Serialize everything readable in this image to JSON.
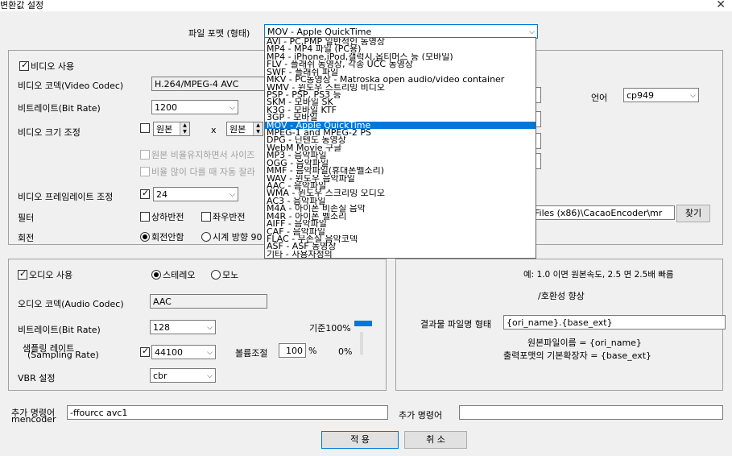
{
  "window": {
    "title": "변환값 설정",
    "close": "✕"
  },
  "format": {
    "label": "파일 포맷 (형태)",
    "selected": "MOV - Apple QuickTime",
    "options": [
      "AVI - PC,PMP 일반적인 동영상",
      "MP4 - MP4 파일 (PC용)",
      "MP4 - iPhone,iPod,갤럭시,옵티머스 등 (모바일)",
      "FLV - 플래쉬 동영상, 각종 UCC 동영상",
      "SWF - 플래쉬 파일",
      "MKV - PC동영상 - Matroska open audio/video container",
      "WMV - 윈도우 스트리밍 비디오",
      "PSP - PSP, PS3 등",
      "SKM - 모바일 SK",
      "K3G - 모바일 KTF",
      "3GP - 모바일",
      "MOV - Apple QuickTime",
      "MPEG-1 and MPEG-2 PS",
      "DPG - 닌텐도 동영상",
      "WebM Movie 구글",
      "MP3 - 음악파일",
      "OGG - 음악파일",
      "MMF - 음악파일(휴대폰벨소리)",
      "WAV - 윈도우 음악파일",
      "AAC - 음악파일",
      "WMA - 윈도우 스크리밍 오디오",
      "AC3 - 음악파일",
      "M4A - 아이폰 비손실 음악",
      "M4R - 아이폰 벨소리",
      "AIFF - 음악파일",
      "CAF - 음악파일",
      "FLAC - 무손실 음악코덱",
      "ASF - ASF 동영상",
      "기타 - 사용자정의"
    ],
    "selected_index": 11
  },
  "video": {
    "enable_label": "비디오 사용",
    "codec_label": "비디오 코덱(Video Codec)",
    "codec_value": "H.264/MPEG-4 AVC",
    "bitrate_label": "비트레이트(Bit Rate)",
    "bitrate_value": "1200",
    "size_label": "비디오 크기 조정",
    "size_w": "원본",
    "size_x": "x",
    "size_h": "원본",
    "keep_ratio": "원본 비율유지하면서 사이즈",
    "auto_crop": "비율 많이 다를 때 자동 잘라",
    "fps_label": "비디오 프레임레이트 조정",
    "fps_value": "24",
    "filter_label": "필터",
    "flip_v": "상하반전",
    "flip_h": "좌우반전",
    "rotate_label": "회전",
    "rotate_none": "회전안함",
    "rotate_cw": "시계 방향 90"
  },
  "right_top": {
    "lang_label": "언어",
    "lang_value": "cp949",
    "path_value": "Files (x86)\\CacaoEncoder\\mr",
    "browse": "찾기"
  },
  "audio": {
    "enable_label": "오디오 사용",
    "stereo": "스테레오",
    "mono": "모노",
    "codec_label": "오디오 코덱(Audio Codec)",
    "codec_value": "AAC",
    "bitrate_label": "비트레이트(Bit Rate)",
    "bitrate_value": "128",
    "base_label": "기준100%",
    "sampling_label1": "샘플링 레이트",
    "sampling_label2": "(Sampling Rate)",
    "sampling_value": "44100",
    "volume_label": "볼륨조절",
    "volume_value": "100",
    "volume_unit": "%",
    "zero": "0%",
    "vbr_label": "VBR 설정",
    "vbr_value": "cbr"
  },
  "right_bottom": {
    "speed_note": "예: 1.0 이면 원본속도, 2.5 면 2.5배 빠름",
    "compat": "/호환성 향상",
    "output_label": "결과물 파일명 형태",
    "output_value": "{ori_name}.{base_ext}",
    "note1": "원본파일이름 = {ori_name}",
    "note2": "출력포맷의 기본확장자 = {base_ext}"
  },
  "extra": {
    "left_label1": "추가 명령어",
    "left_label2": "mencoder",
    "left_value": "-ffourcc avc1",
    "right_label": "추가 명령어",
    "right_value": ""
  },
  "buttons": {
    "apply": "적 용",
    "cancel": "취 소"
  }
}
